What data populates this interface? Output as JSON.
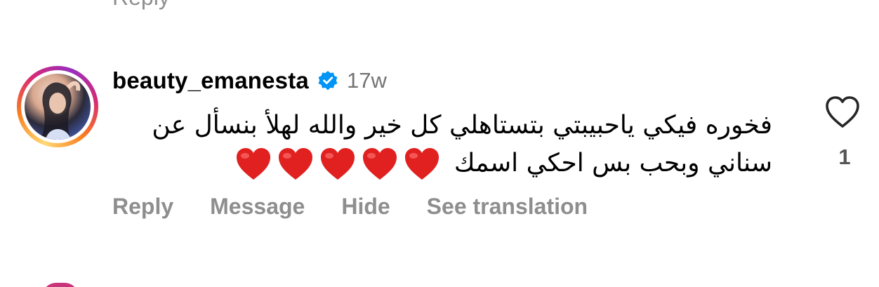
{
  "previous_comment": {
    "reply_label": "Reply"
  },
  "comment": {
    "username": "beauty_emanesta",
    "verified": true,
    "time": "17w",
    "text_line1": "فخوره فيكي ياحبيبتي بتستاهلي كل خير والله لهلأ بنسأل عن",
    "text_line2": "سناني وبحب بس احكي اسمك",
    "hearts": 5,
    "like_count": "1"
  },
  "actions": {
    "reply": "Reply",
    "message": "Message",
    "hide": "Hide",
    "see_translation": "See translation"
  },
  "icons": {
    "verified": "verified-badge-icon",
    "like": "heart-outline-icon",
    "emoji": "red-heart-emoji"
  },
  "colors": {
    "verified_blue": "#0095f6",
    "muted_text": "#8e8e8e",
    "heart_red": "#e0211f"
  }
}
